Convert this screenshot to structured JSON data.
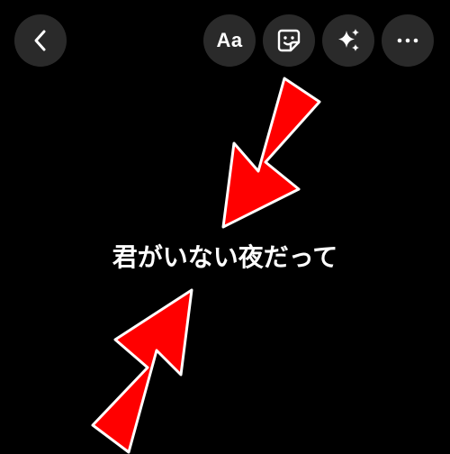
{
  "toolbar": {
    "back_icon": "chevron-left-icon",
    "text_tool_label": "Aa",
    "sticker_icon": "sticker-icon",
    "effects_icon": "sparkles-icon",
    "more_icon": "ellipsis-icon"
  },
  "story": {
    "text": "君がいない夜だって"
  },
  "annotations": {
    "arrow_color": "#ff0000",
    "arrow_outline": "#ffffff"
  },
  "colors": {
    "background": "#000000",
    "button_bg": "#2a2a2a"
  }
}
